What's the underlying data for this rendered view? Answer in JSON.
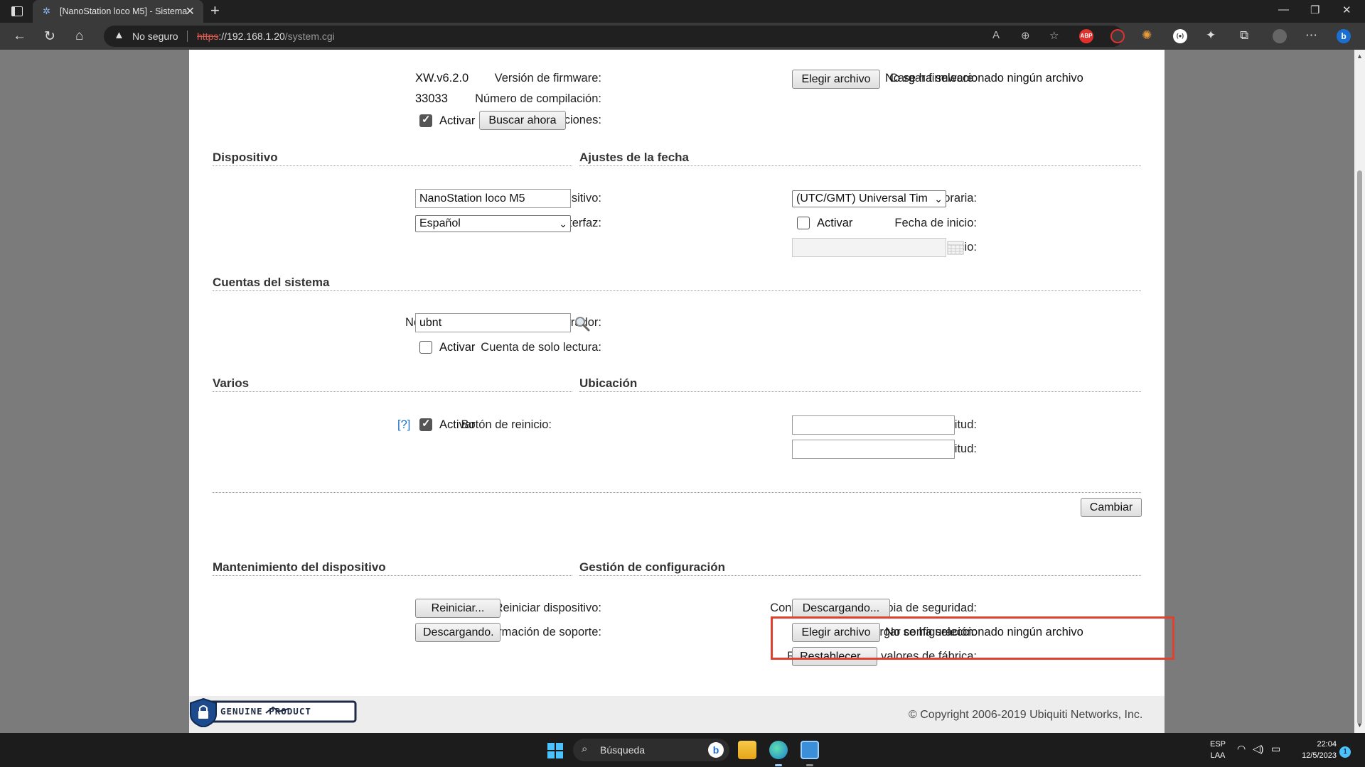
{
  "browser": {
    "tab_title": "[NanoStation loco M5] - Sistema",
    "security_label": "No seguro",
    "url_scheme": "https",
    "url_host": "://192.168.1.20",
    "url_path": "/system.cgi",
    "ext_abp": "ABP"
  },
  "firmware": {
    "version_label": "Versión de firmware:",
    "version_value": "XW.v6.2.0",
    "build_label": "Número de compilación:",
    "build_value": "33033",
    "updates_label": "Buscar actualizaciones:",
    "updates_activate": "Activar",
    "updates_checked": true,
    "check_now_button": "Buscar ahora",
    "upload_label": "Cargar firmware:",
    "choose_file_button": "Elegir archivo",
    "no_file_text": "No se ha seleccionado ningún archivo"
  },
  "device": {
    "section_title": "Dispositivo",
    "name_label": "Nombre de dispositivo:",
    "name_value": "NanoStation loco M5",
    "language_label": "Idioma de la interfaz:",
    "language_value": "Español"
  },
  "date_settings": {
    "section_title": "Ajustes de la fecha",
    "timezone_label": "Zona horaria:",
    "timezone_value": "(UTC/GMT) Universal Tim",
    "start_date_label": "Fecha de inicio:",
    "start_date_activate": "Activar",
    "start_date_checked": false,
    "start_date_field_label": "Fecha de inicio:",
    "start_date_value": ""
  },
  "accounts": {
    "section_title": "Cuentas del sistema",
    "admin_user_label": "Nombre de usuario del administrador:",
    "admin_user_value": "ubnt",
    "readonly_label": "Cuenta de solo lectura:",
    "readonly_activate": "Activar",
    "readonly_checked": false
  },
  "misc": {
    "section_title": "Varios",
    "reset_button_label": "Botón de reinicio:",
    "help_link": "[?]",
    "reset_activate": "Activar",
    "reset_checked": true
  },
  "location": {
    "section_title": "Ubicación",
    "latitude_label": "Latitud:",
    "latitude_value": "",
    "longitude_label": "Longitud:",
    "longitude_value": ""
  },
  "change_button": "Cambiar",
  "maintenance": {
    "section_title": "Mantenimiento del dispositivo",
    "reboot_label": "Reiniciar dispositivo:",
    "reboot_button": "Reiniciar...",
    "support_label": "Información de soporte:",
    "support_button": "Descargando."
  },
  "config": {
    "section_title": "Gestión de configuración",
    "backup_label": "Configuración de la copia de seguridad:",
    "backup_button": "Descargando...",
    "upload_label": "Cargar configuración:",
    "choose_file_button": "Elegir archivo",
    "no_file_text": "No se ha seleccionado ningún archivo",
    "reset_label": "Restablecer a los valores de fábrica:",
    "reset_button": "Restablecer..."
  },
  "footer": {
    "genuine_badge": "GENUINE PRODUCT",
    "copyright": "© Copyright 2006-2019 Ubiquiti Networks, Inc."
  },
  "taskbar": {
    "search_placeholder": "Búsqueda",
    "lang_top": "ESP",
    "lang_bottom": "LAA",
    "time": "22:04",
    "date": "12/5/2023",
    "notification_count": "1"
  },
  "colors": {
    "highlight_box": "#e0402e",
    "link": "#1a6fc9",
    "taskbar_accent": "#4cc2ff"
  }
}
